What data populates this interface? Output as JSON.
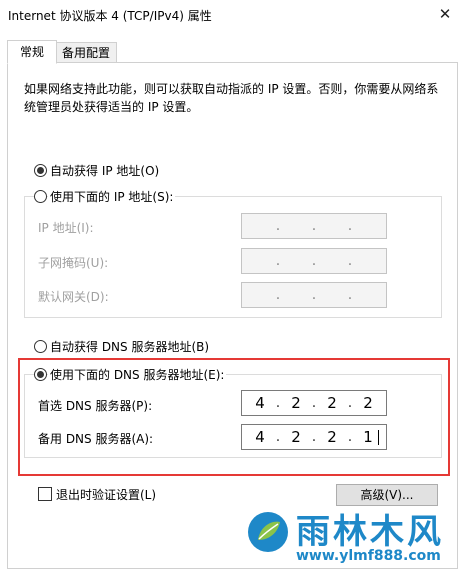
{
  "window": {
    "title": "Internet 协议版本 4 (TCP/IPv4) 属性",
    "close_glyph": "✕"
  },
  "tabs": [
    {
      "label": "常规",
      "active": true
    },
    {
      "label": "备用配置",
      "active": false
    }
  ],
  "description": "如果网络支持此功能，则可以获取自动指派的 IP 设置。否则，你需要从网络系统管理员处获得适当的 IP 设置。",
  "ip_mode": {
    "auto_label": "自动获得 IP 地址(O)",
    "manual_label": "使用下面的 IP 地址(S):",
    "selected": "auto"
  },
  "ip_fields": [
    {
      "label": "IP 地址(I):",
      "octets": [
        "",
        "",
        "",
        ""
      ]
    },
    {
      "label": "子网掩码(U):",
      "octets": [
        "",
        "",
        "",
        ""
      ]
    },
    {
      "label": "默认网关(D):",
      "octets": [
        "",
        "",
        "",
        ""
      ]
    }
  ],
  "dns_mode": {
    "auto_label": "自动获得 DNS 服务器地址(B)",
    "manual_label": "使用下面的 DNS 服务器地址(E):",
    "selected": "manual"
  },
  "dns_fields": [
    {
      "label": "首选 DNS 服务器(P):",
      "octets": [
        "4",
        "2",
        "2",
        "2"
      ]
    },
    {
      "label": "备用 DNS 服务器(A):",
      "octets": [
        "4",
        "2",
        "2",
        "1"
      ]
    }
  ],
  "validate_label": "退出时验证设置(L)",
  "advanced_label": "高级(V)...",
  "watermark": {
    "name": "雨林木风",
    "url": "www.ylmf888.com"
  },
  "colors": {
    "highlight_border": "#e53935",
    "watermark": "#1e88c8"
  }
}
